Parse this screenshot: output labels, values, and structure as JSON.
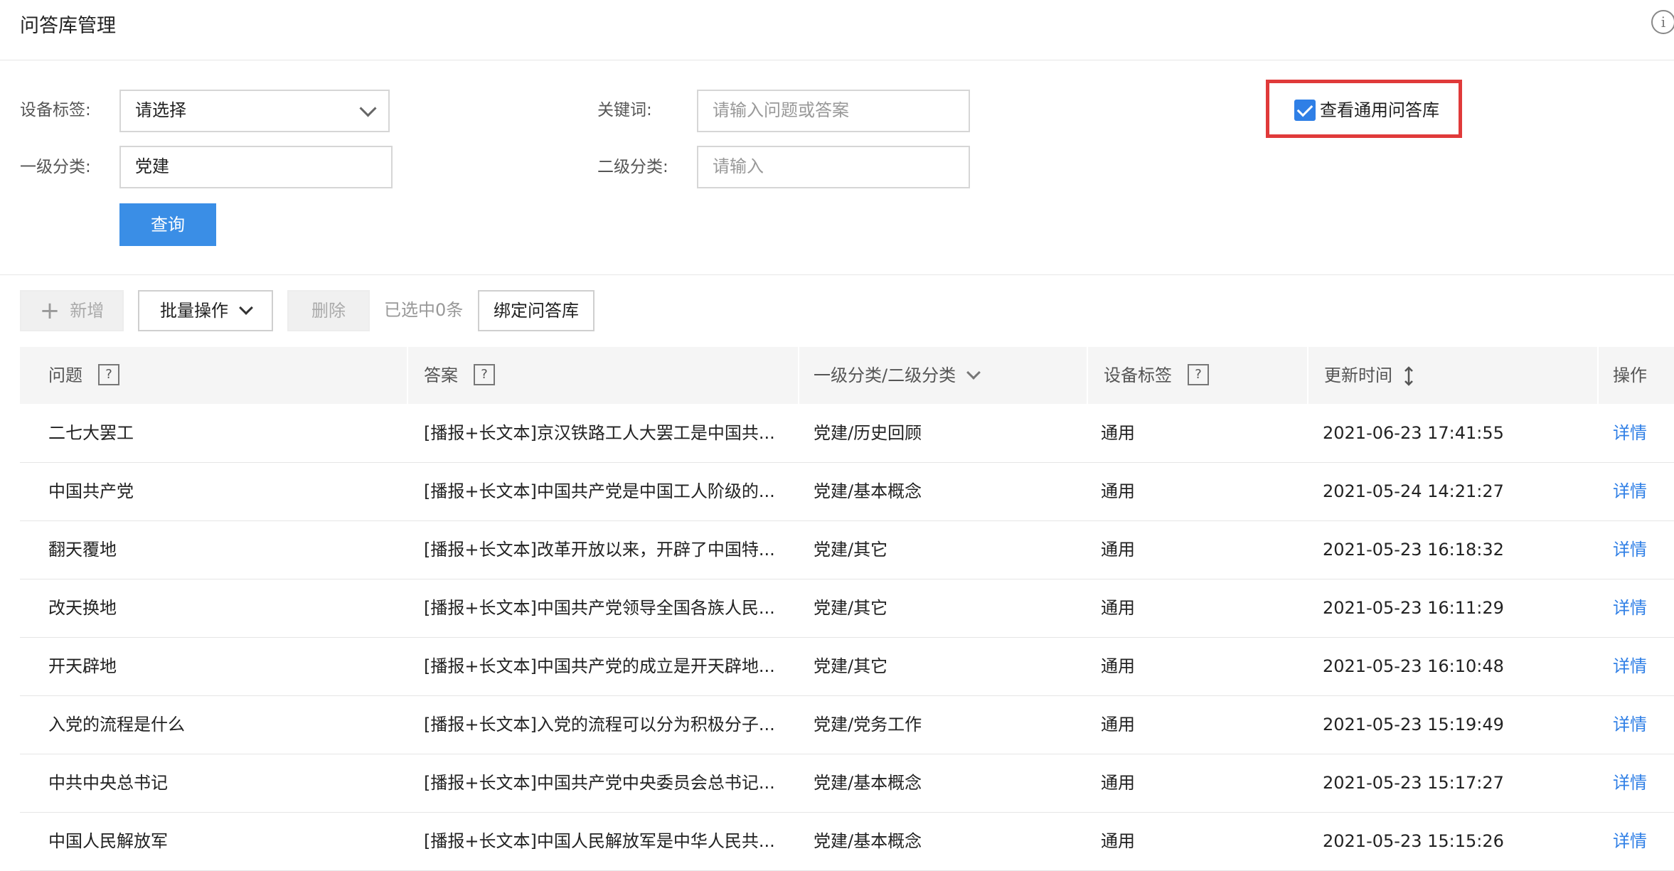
{
  "header": {
    "title": "问答库管理",
    "info_icon": "i"
  },
  "filters": {
    "device_tag_label": "设备标签:",
    "device_tag_value": "请选择",
    "keyword_label": "关键词:",
    "keyword_placeholder": "请输入问题或答案",
    "category1_label": "一级分类:",
    "category1_value": "党建",
    "category2_label": "二级分类:",
    "category2_placeholder": "请输入",
    "query_button": "查询",
    "view_common_label": "查看通用问答库",
    "view_common_checked": true
  },
  "toolbar": {
    "add_label": "新增",
    "batch_label": "批量操作",
    "delete_label": "删除",
    "selected_text": "已选中0条",
    "bind_label": "绑定问答库"
  },
  "table": {
    "columns": [
      "问题",
      "答案",
      "一级分类/二级分类",
      "设备标签",
      "更新时间",
      "操作"
    ],
    "help_glyph": "?",
    "rows": [
      {
        "question": "二七大罢工",
        "answer": "[播报+长文本]京汉铁路工人大罢工是中国共...",
        "category": "党建/历史回顾",
        "tag": "通用",
        "time": "2021-06-23 17:41:55",
        "action": "详情"
      },
      {
        "question": "中国共产党",
        "answer": "[播报+长文本]中国共产党是中国工人阶级的...",
        "category": "党建/基本概念",
        "tag": "通用",
        "time": "2021-05-24 14:21:27",
        "action": "详情"
      },
      {
        "question": "翻天覆地",
        "answer": "[播报+长文本]改革开放以来，开辟了中国特...",
        "category": "党建/其它",
        "tag": "通用",
        "time": "2021-05-23 16:18:32",
        "action": "详情"
      },
      {
        "question": "改天换地",
        "answer": "[播报+长文本]中国共产党领导全国各族人民...",
        "category": "党建/其它",
        "tag": "通用",
        "time": "2021-05-23 16:11:29",
        "action": "详情"
      },
      {
        "question": "开天辟地",
        "answer": "[播报+长文本]中国共产党的成立是开天辟地...",
        "category": "党建/其它",
        "tag": "通用",
        "time": "2021-05-23 16:10:48",
        "action": "详情"
      },
      {
        "question": "入党的流程是什么",
        "answer": "[播报+长文本]入党的流程可以分为积极分子...",
        "category": "党建/党务工作",
        "tag": "通用",
        "time": "2021-05-23 15:19:49",
        "action": "详情"
      },
      {
        "question": "中共中央总书记",
        "answer": "[播报+长文本]中国共产党中央委员会总书记...",
        "category": "党建/基本概念",
        "tag": "通用",
        "time": "2021-05-23 15:17:27",
        "action": "详情"
      },
      {
        "question": "中国人民解放军",
        "answer": "[播报+长文本]中国人民解放军是中华人民共...",
        "category": "党建/基本概念",
        "tag": "通用",
        "time": "2021-05-23 15:15:26",
        "action": "详情"
      }
    ]
  },
  "colors": {
    "primary": "#3a8ee6",
    "link": "#2f7fe6",
    "highlight_frame": "#e03a3a"
  }
}
